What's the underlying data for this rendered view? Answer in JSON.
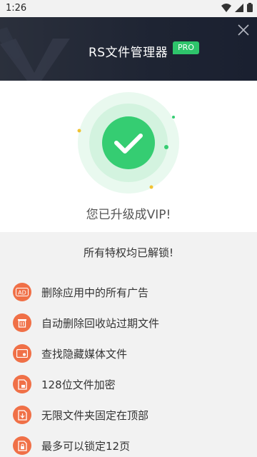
{
  "status_bar": {
    "time": "1:26"
  },
  "header": {
    "title": "RS文件管理器",
    "badge": "PRO"
  },
  "hero": {
    "message": "您已升级成VIP!"
  },
  "features": {
    "heading": "所有特权均已解锁!",
    "items": [
      {
        "icon": "ad-icon",
        "icon_text": "AD",
        "label": "删除应用中的所有广告"
      },
      {
        "icon": "recycle-bin-icon",
        "label": "自动删除回收站过期文件"
      },
      {
        "icon": "hidden-media-icon",
        "label": "查找隐藏媒体文件"
      },
      {
        "icon": "encrypt-icon",
        "label": "128位文件加密"
      },
      {
        "icon": "pin-folder-icon",
        "label": "无限文件夹固定在顶部"
      },
      {
        "icon": "lock-page-icon",
        "label": "最多可以锁定12页"
      }
    ]
  },
  "colors": {
    "accent_green": "#2ec46b",
    "icon_orange": "#f07047",
    "header_dark": "#1e2433"
  }
}
